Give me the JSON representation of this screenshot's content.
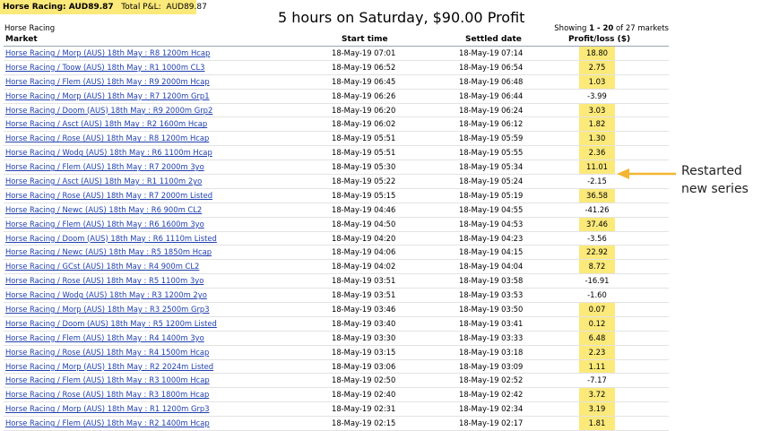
{
  "summary": {
    "category": "Horse Racing: AUD89.87",
    "total_label": "Total P&L:",
    "total_value": "AUD89.87"
  },
  "headline": "5 hours on Saturday, $90.00 Profit",
  "section_label": "Horse Racing",
  "showing": {
    "prefix": "Showing",
    "range": "1 - 20",
    "suffix": "of 27 markets"
  },
  "columns": {
    "market": "Market",
    "start": "Start time",
    "settled": "Settled date",
    "pl": "Profit/loss ($)"
  },
  "rows": [
    {
      "market": "Horse Racing / Morp (AUS) 18th May : R8 1200m Hcap",
      "start": "18-May-19 07:01",
      "settled": "18-May-19 07:14",
      "pl": "18.80"
    },
    {
      "market": "Horse Racing / Toow (AUS) 18th May : R1 1000m CL3",
      "start": "18-May-19 06:52",
      "settled": "18-May-19 06:54",
      "pl": "2.75"
    },
    {
      "market": "Horse Racing / Flem (AUS) 18th May : R9 2000m Hcap",
      "start": "18-May-19 06:45",
      "settled": "18-May-19 06:48",
      "pl": "1.03"
    },
    {
      "market": "Horse Racing / Morp (AUS) 18th May : R7 1200m Grp1",
      "start": "18-May-19 06:26",
      "settled": "18-May-19 06:44",
      "pl": "-3.99"
    },
    {
      "market": "Horse Racing / Doom (AUS) 18th May : R9 2000m Grp2",
      "start": "18-May-19 06:20",
      "settled": "18-May-19 06:24",
      "pl": "3.03"
    },
    {
      "market": "Horse Racing / Asct (AUS) 18th May : R2 1600m Hcap",
      "start": "18-May-19 06:02",
      "settled": "18-May-19 06:12",
      "pl": "1.82"
    },
    {
      "market": "Horse Racing / Rose (AUS) 18th May : R8 1200m Hcap",
      "start": "18-May-19 05:51",
      "settled": "18-May-19 05:59",
      "pl": "1.30"
    },
    {
      "market": "Horse Racing / Wodg (AUS) 18th May : R6 1100m Hcap",
      "start": "18-May-19 05:51",
      "settled": "18-May-19 05:55",
      "pl": "2.36"
    },
    {
      "market": "Horse Racing / Flem (AUS) 18th May : R7 2000m 3yo",
      "start": "18-May-19 05:30",
      "settled": "18-May-19 05:34",
      "pl": "11.01"
    },
    {
      "market": "Horse Racing / Asct (AUS) 18th May : R1 1100m 2yo",
      "start": "18-May-19 05:22",
      "settled": "18-May-19 05:24",
      "pl": "-2.15"
    },
    {
      "market": "Horse Racing / Rose (AUS) 18th May : R7 2000m Listed",
      "start": "18-May-19 05:15",
      "settled": "18-May-19 05:19",
      "pl": "36.58"
    },
    {
      "market": "Horse Racing / Newc (AUS) 18th May : R6 900m CL2",
      "start": "18-May-19 04:46",
      "settled": "18-May-19 04:55",
      "pl": "-41.26"
    },
    {
      "market": "Horse Racing / Flem (AUS) 18th May : R6 1600m 3yo",
      "start": "18-May-19 04:50",
      "settled": "18-May-19 04:53",
      "pl": "37.46"
    },
    {
      "market": "Horse Racing / Doom (AUS) 18th May : R6 1110m Listed",
      "start": "18-May-19 04:20",
      "settled": "18-May-19 04:23",
      "pl": "-3.56"
    },
    {
      "market": "Horse Racing / Newc (AUS) 18th May : R5 1850m Hcap",
      "start": "18-May-19 04:06",
      "settled": "18-May-19 04:15",
      "pl": "22.92"
    },
    {
      "market": "Horse Racing / GCst (AUS) 18th May : R4 900m CL2",
      "start": "18-May-19 04:02",
      "settled": "18-May-19 04:04",
      "pl": "8.72"
    },
    {
      "market": "Horse Racing / Rose (AUS) 18th May : R5 1100m 3yo",
      "start": "18-May-19 03:51",
      "settled": "18-May-19 03:58",
      "pl": "-16.91"
    },
    {
      "market": "Horse Racing / Wodg (AUS) 18th May : R3 1200m 2yo",
      "start": "18-May-19 03:51",
      "settled": "18-May-19 03:53",
      "pl": "-1.60"
    },
    {
      "market": "Horse Racing / Morp (AUS) 18th May : R3 2500m Grp3",
      "start": "18-May-19 03:46",
      "settled": "18-May-19 03:50",
      "pl": "0.07"
    },
    {
      "market": "Horse Racing / Doom (AUS) 18th May : R5 1200m Listed",
      "start": "18-May-19 03:40",
      "settled": "18-May-19 03:41",
      "pl": "0.12"
    },
    {
      "market": "Horse Racing / Flem (AUS) 18th May : R4 1400m 3yo",
      "start": "18-May-19 03:30",
      "settled": "18-May-19 03:33",
      "pl": "6.48"
    },
    {
      "market": "Horse Racing / Rose (AUS) 18th May : R4 1500m Hcap",
      "start": "18-May-19 03:15",
      "settled": "18-May-19 03:18",
      "pl": "2.23"
    },
    {
      "market": "Horse Racing / Morp (AUS) 18th May : R2 2024m Listed",
      "start": "18-May-19 03:06",
      "settled": "18-May-19 03:09",
      "pl": "1.11"
    },
    {
      "market": "Horse Racing / Flem (AUS) 18th May : R3 1000m Hcap",
      "start": "18-May-19 02:50",
      "settled": "18-May-19 02:52",
      "pl": "-7.17"
    },
    {
      "market": "Horse Racing / Rose (AUS) 18th May : R3 1800m Hcap",
      "start": "18-May-19 02:40",
      "settled": "18-May-19 02:42",
      "pl": "3.72"
    },
    {
      "market": "Horse Racing / Morp (AUS) 18th May : R1 1200m Grp3",
      "start": "18-May-19 02:31",
      "settled": "18-May-19 02:34",
      "pl": "3.19"
    },
    {
      "market": "Horse Racing / Flem (AUS) 18th May : R2 1400m Hcap",
      "start": "18-May-19 02:15",
      "settled": "18-May-19 02:17",
      "pl": "1.81"
    }
  ],
  "annotation": {
    "line1": "Restarted",
    "line2": "new series"
  },
  "colors": {
    "highlight": "#fbe97a",
    "link": "#1f3fae",
    "arrow": "#f2b632"
  }
}
